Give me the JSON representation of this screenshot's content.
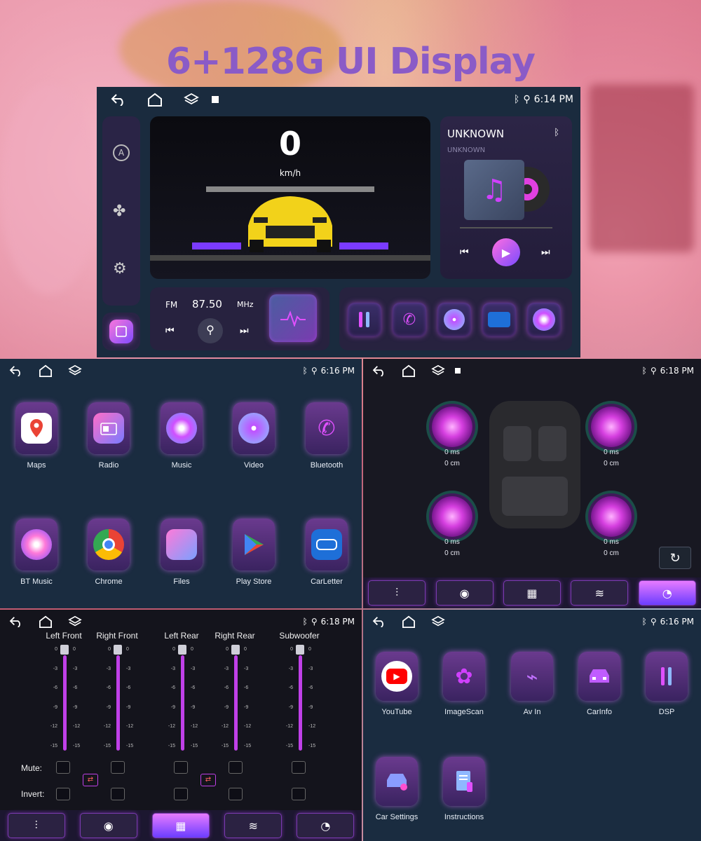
{
  "title": "6+128G UI Display",
  "colors": {
    "accent": "#d64cf0",
    "panel_bg": "#1a2c40",
    "brand_title": "#8a5bc7"
  },
  "home": {
    "time": "6:14 PM",
    "speed_value": "0",
    "speed_unit": "km/h",
    "music_title": "UNKNOWN",
    "music_artist": "UNKNOWN",
    "radio_band": "FM",
    "radio_freq": "87.50",
    "radio_unit": "MHz",
    "left_rail_icons": [
      "auto-mode-icon",
      "fan-icon",
      "settings-icon",
      "screen-capture-icon"
    ],
    "shortcut_icons": [
      "dsp-icon",
      "bluetooth-phone-icon",
      "video-icon",
      "carletter-icon",
      "music-icon"
    ]
  },
  "apps_screen": {
    "time": "6:16 PM",
    "apps": [
      {
        "label": "Maps",
        "icon": "maps-icon"
      },
      {
        "label": "Radio",
        "icon": "radio-icon"
      },
      {
        "label": "Music",
        "icon": "music-icon"
      },
      {
        "label": "Video",
        "icon": "video-icon"
      },
      {
        "label": "Bluetooth",
        "icon": "bluetooth-icon"
      },
      {
        "label": "BT Music",
        "icon": "bt-music-icon"
      },
      {
        "label": "Chrome",
        "icon": "chrome-icon"
      },
      {
        "label": "Files",
        "icon": "files-icon"
      },
      {
        "label": "Play Store",
        "icon": "play-store-icon"
      },
      {
        "label": "CarLetter",
        "icon": "carletter-icon"
      }
    ]
  },
  "delay_screen": {
    "time": "6:18 PM",
    "speakers": [
      {
        "ms": "0 ms",
        "cm": "0 cm"
      },
      {
        "ms": "0 ms",
        "cm": "0 cm"
      },
      {
        "ms": "0 ms",
        "cm": "0 cm"
      },
      {
        "ms": "0 ms",
        "cm": "0 cm"
      }
    ]
  },
  "dsp_screen": {
    "time": "6:18 PM",
    "channels": [
      "Left Front",
      "Right Front",
      "Left Rear",
      "Right Rear",
      "Subwoofer"
    ],
    "ticks": [
      "0",
      "-3",
      "-6",
      "-9",
      "-12",
      "-15"
    ],
    "mute_label": "Mute:",
    "invert_label": "Invert:"
  },
  "apps2_screen": {
    "time": "6:16 PM",
    "apps": [
      {
        "label": "YouTube",
        "icon": "youtube-icon"
      },
      {
        "label": "ImageScan",
        "icon": "imagescan-icon"
      },
      {
        "label": "Av In",
        "icon": "av-in-icon"
      },
      {
        "label": "CarInfo",
        "icon": "carinfo-icon"
      },
      {
        "label": "DSP",
        "icon": "dsp-icon"
      },
      {
        "label": "Car Settings",
        "icon": "car-settings-icon"
      },
      {
        "label": "Instructions",
        "icon": "instructions-icon"
      }
    ]
  }
}
